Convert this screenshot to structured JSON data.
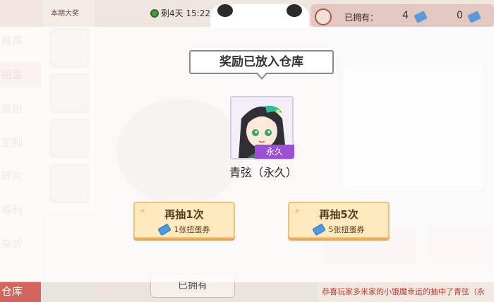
{
  "background": {
    "side_menu": [
      "推荐",
      "扭蛋",
      "装扮",
      "定制",
      "碎片",
      "福利",
      "杂货"
    ],
    "side_bottom": "仓库",
    "prize_column_title": "本期大奖",
    "timer": "剩4天 15:22",
    "owned_label": "已拥有：",
    "owned_count_1": "4",
    "owned_count_2": "0",
    "owned_button": "已拥有",
    "marquee": "恭喜玩家多米家的小饿魔幸运的抽中了青弦（永"
  },
  "modal": {
    "title": "奖励已放入仓库",
    "item_badge": "永久",
    "item_name": "青弦（永久）",
    "buttons": [
      {
        "label": "再抽1次",
        "cost": "1张扭蛋券"
      },
      {
        "label": "再抽5次",
        "cost": "5张扭蛋券"
      }
    ]
  },
  "colors": {
    "badge": "#9b4fd2",
    "button_fill": "#fde9be",
    "button_border": "#f2c27c",
    "ticket": "#4d9be0"
  }
}
